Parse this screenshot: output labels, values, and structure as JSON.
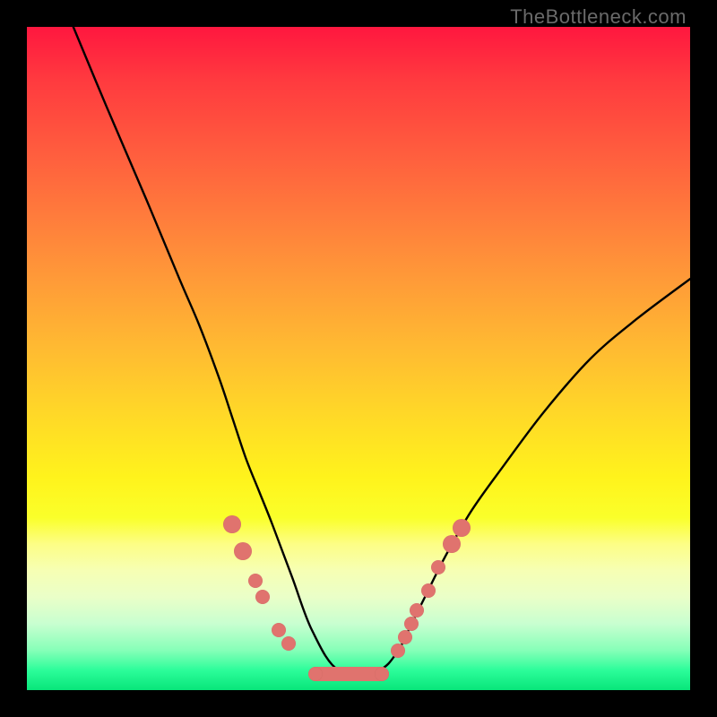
{
  "watermark": "TheBottleneck.com",
  "chart_data": {
    "type": "line",
    "title": "",
    "xlabel": "",
    "ylabel": "",
    "xlim": [
      0,
      100
    ],
    "ylim": [
      0,
      100
    ],
    "grid": false,
    "series": [
      {
        "name": "curve",
        "x": [
          7,
          12,
          18,
          23,
          26,
          29,
          31,
          33,
          35,
          37,
          40,
          43,
          47,
          53,
          56,
          58,
          60,
          63,
          67,
          72,
          78,
          85,
          92,
          100
        ],
        "y": [
          100,
          88,
          74,
          62,
          55,
          47,
          41,
          35,
          30,
          25,
          17,
          9,
          3,
          3,
          6,
          10,
          14,
          20,
          27,
          34,
          42,
          50,
          56,
          62
        ]
      }
    ],
    "markers_left": [
      {
        "x": 31.0,
        "y": 25.0
      },
      {
        "x": 32.5,
        "y": 21.0
      },
      {
        "x": 34.5,
        "y": 16.5
      },
      {
        "x": 35.5,
        "y": 14.0
      },
      {
        "x": 38.0,
        "y": 9.0
      },
      {
        "x": 39.5,
        "y": 7.0
      }
    ],
    "markers_right": [
      {
        "x": 56.0,
        "y": 6.0
      },
      {
        "x": 57.0,
        "y": 8.0
      },
      {
        "x": 58.0,
        "y": 10.0
      },
      {
        "x": 58.8,
        "y": 12.0
      },
      {
        "x": 60.5,
        "y": 15.0
      },
      {
        "x": 62.0,
        "y": 18.5
      },
      {
        "x": 64.0,
        "y": 22.0
      },
      {
        "x": 65.5,
        "y": 24.5
      }
    ],
    "bottom_bar": {
      "x_start": 43.5,
      "x_end": 53.5,
      "y": 2.5
    }
  }
}
